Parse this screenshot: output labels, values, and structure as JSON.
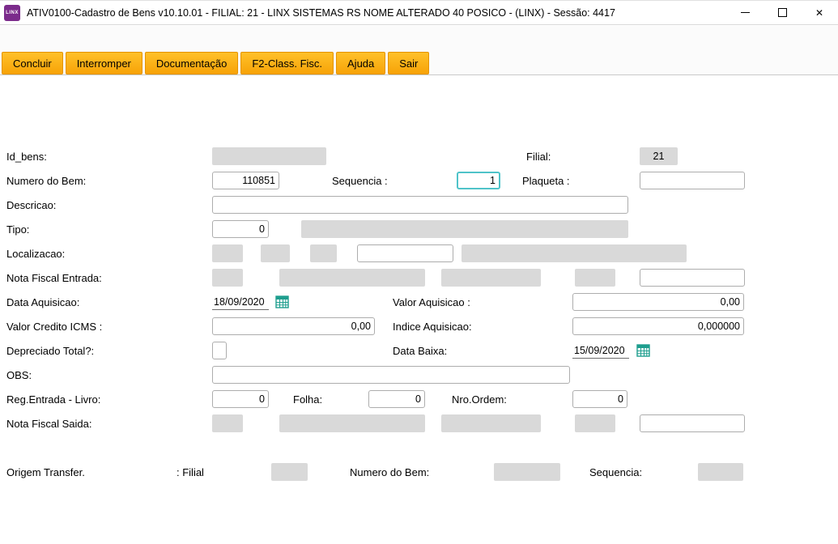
{
  "window": {
    "logo": "LINX",
    "title": "ATIV0100-Cadastro de Bens v10.10.01  - FILIAL: 21 - LINX SISTEMAS RS NOME ALTERADO 40 POSICO - (LINX) - Sessão: 4417",
    "close_glyph": "✕"
  },
  "toolbar": {
    "concluir": "Concluir",
    "interromper": "Interromper",
    "documentacao": "Documentação",
    "f2_class_fisc": "F2-Class. Fisc.",
    "ajuda": "Ajuda",
    "sair": "Sair"
  },
  "form": {
    "labels": {
      "id_bens": "Id_bens:",
      "filial": "Filial:",
      "numero_bem": "Numero do Bem:",
      "sequencia": "Sequencia :",
      "plaqueta": "Plaqueta :",
      "descricao": "Descricao:",
      "tipo": "Tipo:",
      "localizacao": "Localizacao:",
      "nota_fiscal_entrada": "Nota Fiscal Entrada:",
      "data_aquisicao": "Data Aquisicao:",
      "valor_aquisicao": "Valor Aquisicao :",
      "valor_credito_icms": "Valor Credito ICMS :",
      "indice_aquisicao": "Indice Aquisicao:",
      "depreciado_total": "Depreciado Total?:",
      "data_baixa": "Data Baixa:",
      "obs": "OBS:",
      "reg_entrada_livro": "Reg.Entrada - Livro:",
      "folha": "Folha:",
      "nro_ordem": "Nro.Ordem:",
      "nota_fiscal_saida": "Nota Fiscal Saida:",
      "origem_transfer": "Origem Transfer.",
      "origem_filial": ": Filial",
      "origem_numero_bem": "Numero do Bem:",
      "origem_sequencia": "Sequencia:"
    },
    "values": {
      "filial": "21",
      "numero_bem": "110851",
      "sequencia": "1",
      "tipo": "0",
      "data_aquisicao": "18/09/2020",
      "valor_aquisicao": "0,00",
      "valor_credito_icms": "0,00",
      "indice_aquisicao": "0,000000",
      "data_baixa": "15/09/2020",
      "reg_entrada_livro": "0",
      "folha": "0",
      "nro_ordem": "0"
    }
  },
  "colors": {
    "accent_orange": "#f7a307",
    "focus_teal": "#4fc3c9",
    "disabled_gray": "#d9d9d9",
    "calendar_teal": "#1e9e8e",
    "logo_purple": "#7b2b8b"
  }
}
